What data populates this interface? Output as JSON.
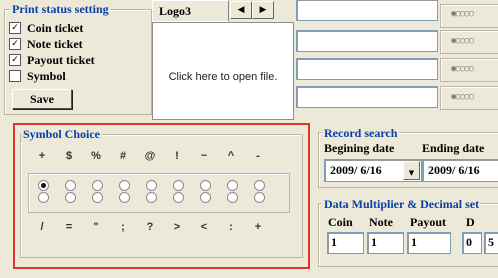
{
  "print_status": {
    "title": "Print status setting",
    "items": [
      {
        "label": "Coin ticket",
        "checked": true
      },
      {
        "label": "Note ticket",
        "checked": true
      },
      {
        "label": "Payout ticket",
        "checked": true
      },
      {
        "label": "Symbol",
        "checked": false
      }
    ],
    "save_label": "Save"
  },
  "logo": {
    "tab_label": "Logo3",
    "prev_arrow": "◀",
    "next_arrow": "▶",
    "open_hint": "Click here to open file."
  },
  "symbol_choice": {
    "title": "Symbol Choice",
    "top_symbols": [
      "+",
      "$",
      "%",
      "#",
      "@",
      "!",
      "~",
      "^",
      "-"
    ],
    "selected_radio": 0,
    "radio_columns": 9,
    "bottom_symbols": [
      "/",
      "=",
      "\"",
      ";",
      "?",
      ">",
      "<",
      ":",
      "+"
    ]
  },
  "record_search": {
    "title": "Record search",
    "begin_label": "Begining date",
    "end_label": "Ending date",
    "begin_value": "2009/ 6/16",
    "end_value": "2009/ 6/16",
    "dropdown_icon": "▼"
  },
  "multiplier": {
    "title": "Data Multiplier  & Decimal set",
    "headers": [
      "Coin",
      "Note",
      "Payout",
      "D"
    ],
    "values": [
      "1",
      "1",
      "1",
      "0"
    ],
    "extra_value": "5"
  },
  "highlight_color": "#e0372d",
  "title_color": "#0a3fa8"
}
